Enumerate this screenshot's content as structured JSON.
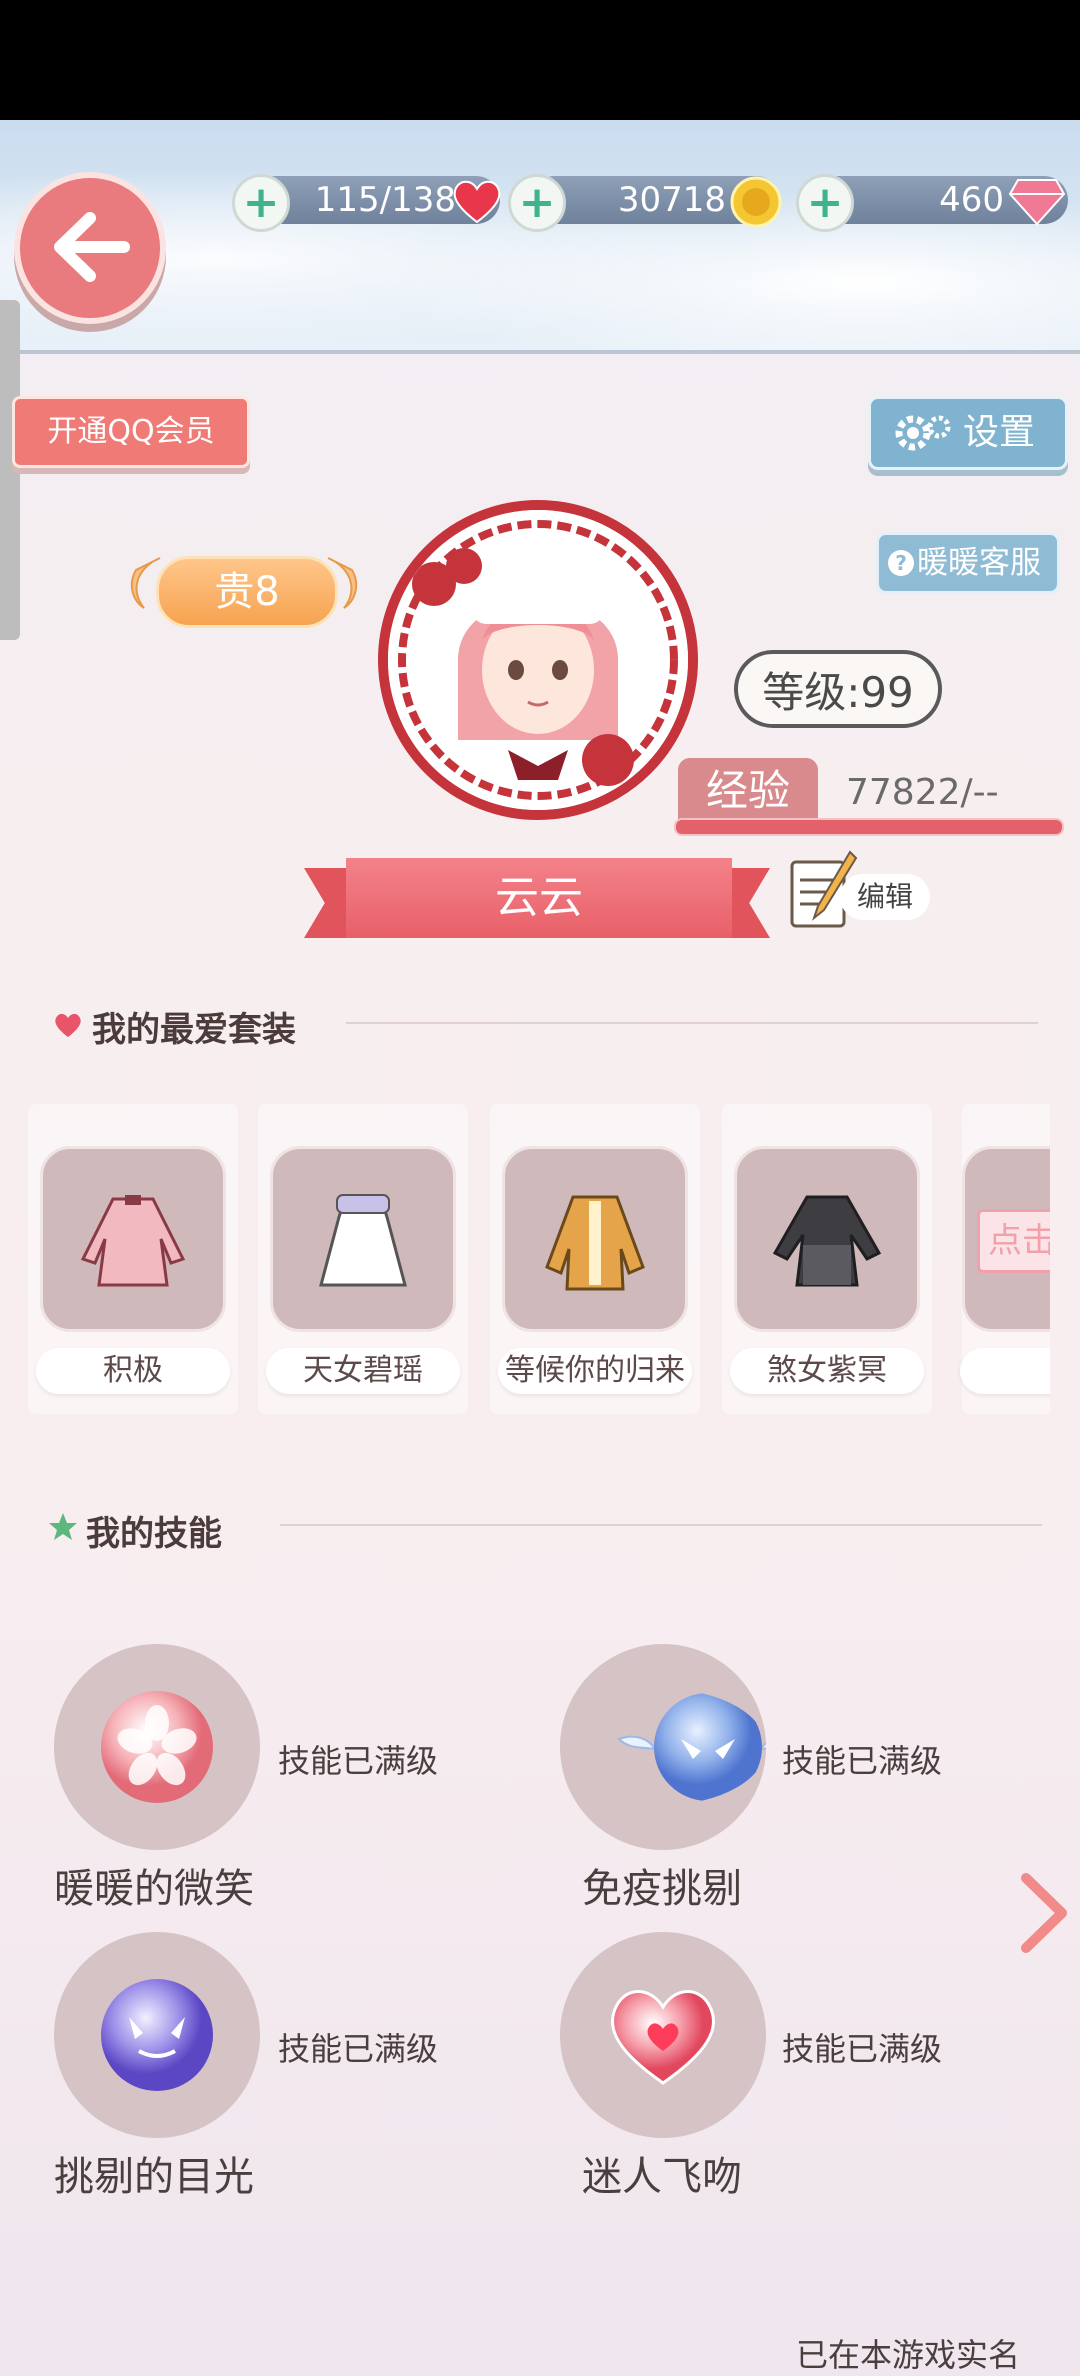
{
  "header": {
    "stamina": "115/138",
    "gold": "30718",
    "diamonds": "460"
  },
  "buttons": {
    "qq_member": "开通QQ会员",
    "settings": "设置",
    "customer_service": "暖暖客服",
    "edit": "编辑"
  },
  "profile": {
    "noble_level": "贵8",
    "level": "等级:99",
    "exp_label": "经验",
    "exp_value": "77822/--",
    "name": "云云"
  },
  "favorites": {
    "title": "我的最爱套装",
    "items": [
      {
        "name": "积极"
      },
      {
        "name": "天女碧瑶"
      },
      {
        "name": "等候你的归来"
      },
      {
        "name": "煞女紫冥"
      },
      {
        "name": "",
        "hint": "点击"
      }
    ]
  },
  "skills": {
    "title": "我的技能",
    "items": [
      {
        "name": "暖暖的微笑",
        "status": "技能已满级"
      },
      {
        "name": "免疫挑剔",
        "status": "技能已满级"
      },
      {
        "name": "挑剔的目光",
        "status": "技能已满级"
      },
      {
        "name": "迷人飞吻",
        "status": "技能已满级"
      }
    ]
  },
  "footer": {
    "realname": "已在本游戏实名"
  },
  "colors": {
    "accent_pink": "#e86068",
    "accent_blue": "#7fb3cf",
    "plus_green": "#3fb38b"
  },
  "icons": [
    "back-arrow-icon",
    "plus-icon",
    "heart-icon",
    "coin-icon",
    "diamond-icon",
    "gear-icon",
    "question-icon",
    "pencil-note-icon",
    "star-icon",
    "chevron-right-icon"
  ]
}
